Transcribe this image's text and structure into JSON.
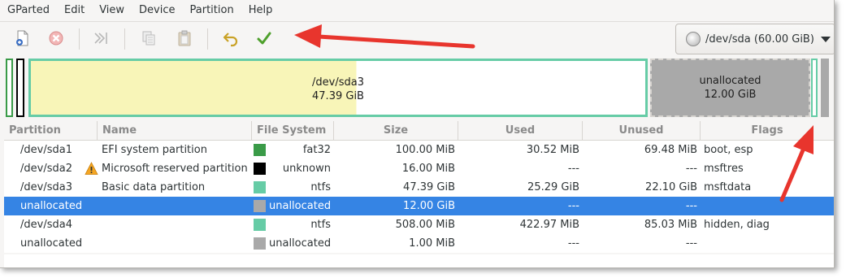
{
  "menubar": {
    "items": [
      "GParted",
      "Edit",
      "View",
      "Device",
      "Partition",
      "Help"
    ]
  },
  "toolbar": {
    "buttons": [
      {
        "icon": "new-partition-icon"
      },
      {
        "icon": "delete-icon"
      },
      {
        "icon": "resize-move-icon"
      },
      {
        "icon": "copy-icon"
      },
      {
        "icon": "paste-icon"
      },
      {
        "icon": "undo-icon"
      },
      {
        "icon": "apply-icon"
      }
    ],
    "device_selector": "/dev/sda (60.00 GiB)"
  },
  "graphic": {
    "main_partition": {
      "name": "/dev/sda3",
      "size": "47.39 GiB"
    },
    "unallocated": {
      "name": "unallocated",
      "size": "12.00 GiB"
    }
  },
  "table": {
    "columns": [
      "Partition",
      "Name",
      "File System",
      "Size",
      "Used",
      "Unused",
      "Flags"
    ],
    "rows": [
      {
        "partition": "/dev/sda1",
        "name": "EFI system partition",
        "fs": "fat32",
        "fs_color": "#3a9b48",
        "size": "100.00 MiB",
        "used": "30.52 MiB",
        "unused": "69.48 MiB",
        "flags": "boot, esp",
        "warning": false,
        "selected": false
      },
      {
        "partition": "/dev/sda2",
        "name": "Microsoft reserved partition",
        "fs": "unknown",
        "fs_color": "#000000",
        "size": "16.00 MiB",
        "used": "---",
        "unused": "---",
        "flags": "msftres",
        "warning": true,
        "selected": false
      },
      {
        "partition": "/dev/sda3",
        "name": "Basic data partition",
        "fs": "ntfs",
        "fs_color": "#66cca6",
        "size": "47.39 GiB",
        "used": "25.29 GiB",
        "unused": "22.10 GiB",
        "flags": "msftdata",
        "warning": false,
        "selected": false
      },
      {
        "partition": "unallocated",
        "name": "",
        "fs": "unallocated",
        "fs_color": "#a9a9a9",
        "size": "12.00 GiB",
        "used": "---",
        "unused": "---",
        "flags": "",
        "warning": false,
        "selected": true
      },
      {
        "partition": "/dev/sda4",
        "name": "",
        "fs": "ntfs",
        "fs_color": "#66cca6",
        "size": "508.00 MiB",
        "used": "422.97 MiB",
        "unused": "85.03 MiB",
        "flags": "hidden, diag",
        "warning": false,
        "selected": false
      },
      {
        "partition": "unallocated",
        "name": "",
        "fs": "unallocated",
        "fs_color": "#a9a9a9",
        "size": "1.00 MiB",
        "used": "---",
        "unused": "---",
        "flags": "",
        "warning": false,
        "selected": false
      }
    ]
  },
  "colors": {
    "selection": "#3584e4",
    "annotation_arrow": "#e8352d",
    "ntfs": "#66cca6",
    "fat32": "#3a9b48",
    "unallocated": "#a9a9a9",
    "used_space": "#f8f5b8"
  }
}
